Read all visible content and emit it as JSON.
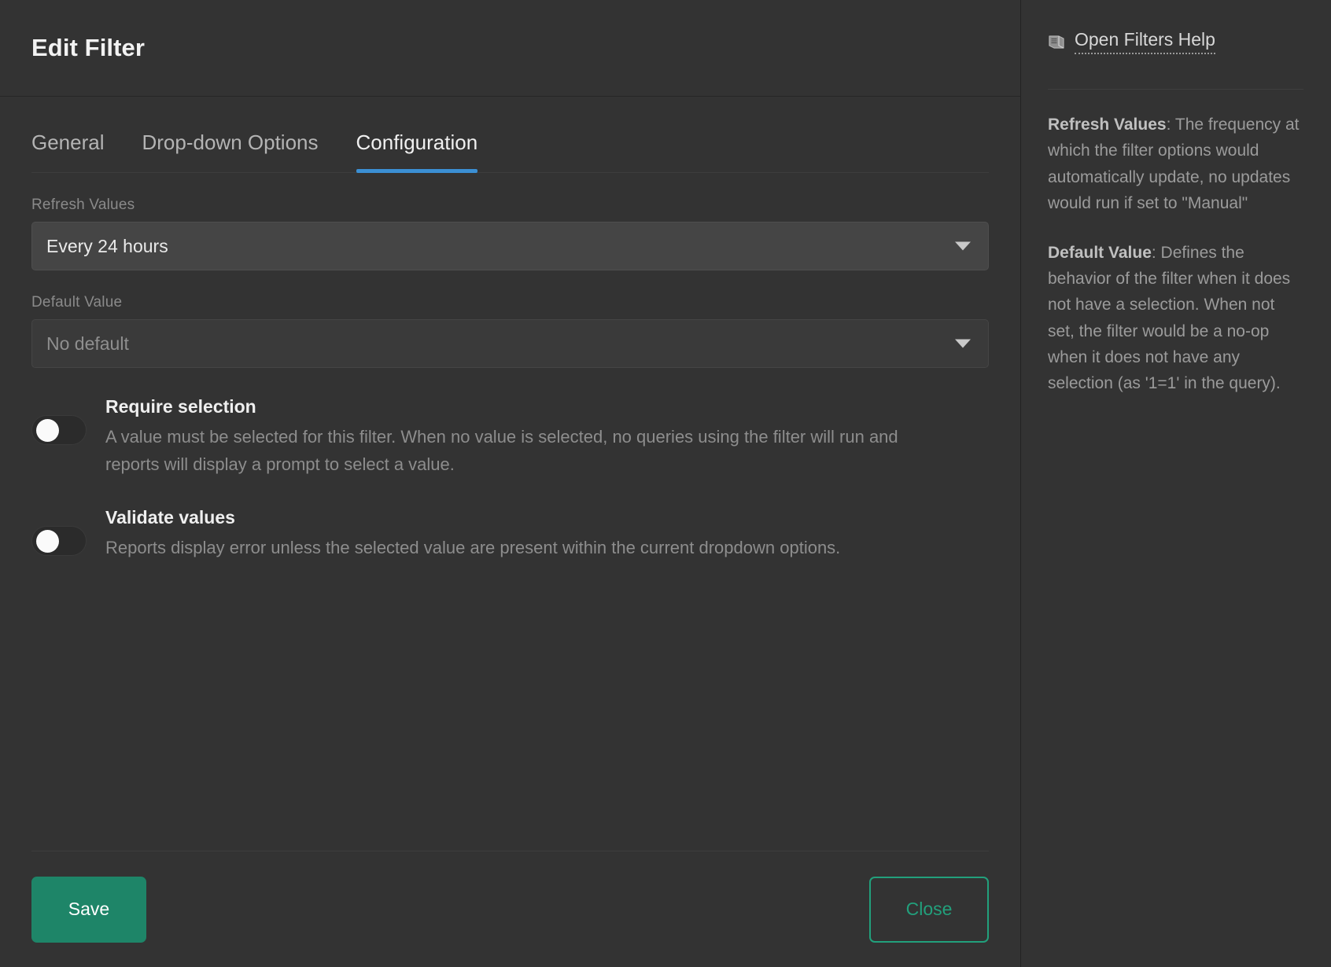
{
  "modal": {
    "title": "Edit Filter",
    "tabs": [
      {
        "label": "General",
        "active": false
      },
      {
        "label": "Drop-down Options",
        "active": false
      },
      {
        "label": "Configuration",
        "active": true
      }
    ],
    "fields": {
      "refresh_values": {
        "label": "Refresh Values",
        "value": "Every 24 hours",
        "caret_icon": "chevron-down-icon"
      },
      "default_value": {
        "label": "Default Value",
        "placeholder": "No default",
        "value": "",
        "caret_icon": "chevron-down-icon"
      }
    },
    "toggles": [
      {
        "name": "require-selection",
        "title": "Require selection",
        "description": "A value must be selected for this filter. When no value is selected, no queries using the filter will run and reports will display a prompt to select a value.",
        "state": "off"
      },
      {
        "name": "validate-values",
        "title": "Validate values",
        "description": "Reports display error unless the selected value are present within the current dropdown options.",
        "state": "off"
      }
    ],
    "footer": {
      "save_label": "Save",
      "close_label": "Close"
    }
  },
  "help": {
    "link_icon": "book-icon",
    "link_label": "Open Filters Help",
    "paragraphs": [
      {
        "term": "Refresh Values",
        "text": ": The frequency at which the filter options would automatically update, no updates would run if set to \"Manual\""
      },
      {
        "term": "Default Value",
        "text": ": Defines the behavior of the filter when it does not have a selection. When not set, the filter would be a no-op when it does not have any selection (as '1=1' in the query)."
      }
    ]
  },
  "colors": {
    "accent_tab": "#3b8fd4",
    "accent_save": "#1e8568",
    "accent_close": "#22a07c",
    "background": "#333333"
  }
}
